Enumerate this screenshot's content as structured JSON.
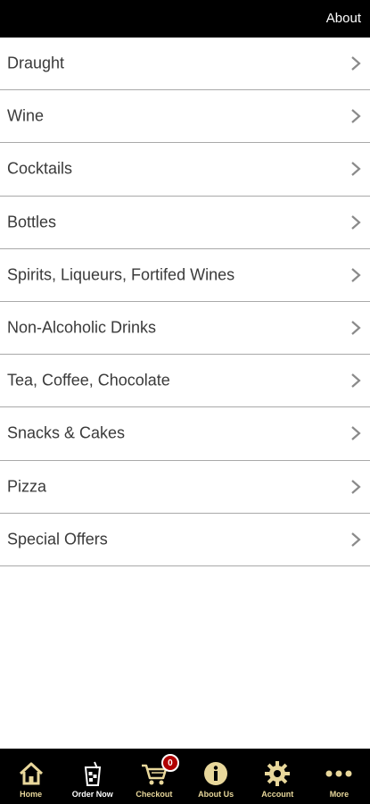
{
  "header": {
    "about_label": "About"
  },
  "menu": {
    "items": [
      {
        "label": "Draught"
      },
      {
        "label": "Wine"
      },
      {
        "label": "Cocktails"
      },
      {
        "label": "Bottles"
      },
      {
        "label": "Spirits, Liqueurs, Fortifed Wines"
      },
      {
        "label": "Non-Alcoholic Drinks"
      },
      {
        "label": "Tea, Coffee, Chocolate"
      },
      {
        "label": "Snacks & Cakes"
      },
      {
        "label": "Pizza"
      },
      {
        "label": "Special Offers"
      }
    ],
    "chevron_icon": "chevron-right-icon"
  },
  "tabbar": {
    "tabs": [
      {
        "label": "Home",
        "icon": "home-icon"
      },
      {
        "label": "Order Now",
        "icon": "drink-glass-icon"
      },
      {
        "label": "Checkout",
        "icon": "cart-icon",
        "badge": "0"
      },
      {
        "label": "About Us",
        "icon": "info-icon"
      },
      {
        "label": "Account",
        "icon": "gear-icon"
      },
      {
        "label": "More",
        "icon": "more-dots-icon"
      }
    ],
    "active_tab": "Order Now"
  },
  "colors": {
    "bar_background": "#000000",
    "icon_gold": "#e8d79b",
    "badge_red": "#b00000",
    "divider": "#a9a9a9",
    "text": "#3a3a3a"
  }
}
